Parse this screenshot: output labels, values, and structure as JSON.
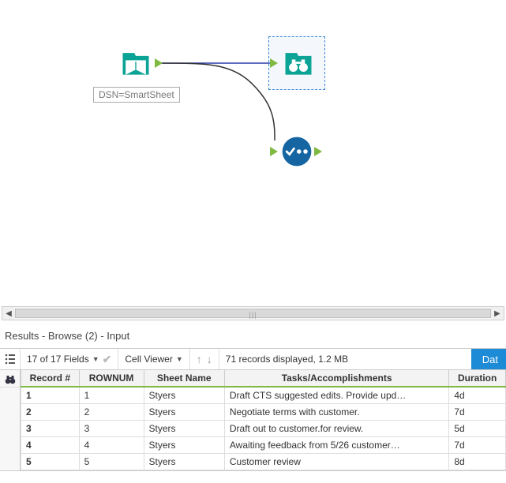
{
  "canvas": {
    "input_node_label": "DSN=SmartSheet"
  },
  "results": {
    "title": "Results - Browse (2) - Input",
    "fields_summary": "17 of 17 Fields",
    "cell_viewer": "Cell Viewer",
    "records_summary": "71 records displayed, 1.2 MB",
    "data_button": "Dat",
    "columns": {
      "record": "Record #",
      "rownum": "ROWNUM",
      "sheet": "Sheet Name",
      "tasks": "Tasks/Accomplishments",
      "duration": "Duration"
    },
    "rows": [
      {
        "record": "1",
        "rownum": "1",
        "sheet": "Styers",
        "task": "Draft CTS suggested edits. Provide upd…",
        "duration": "4d"
      },
      {
        "record": "2",
        "rownum": "2",
        "sheet": "Styers",
        "task": "Negotiate terms with customer.",
        "duration": "7d"
      },
      {
        "record": "3",
        "rownum": "3",
        "sheet": "Styers",
        "task": "Draft out to customer.for review.",
        "duration": "5d"
      },
      {
        "record": "4",
        "rownum": "4",
        "sheet": "Styers",
        "task": "Awaiting feedback from 5/26 customer…",
        "duration": "7d"
      },
      {
        "record": "5",
        "rownum": "5",
        "sheet": "Styers",
        "task": "Customer review",
        "duration": "8d"
      }
    ]
  }
}
